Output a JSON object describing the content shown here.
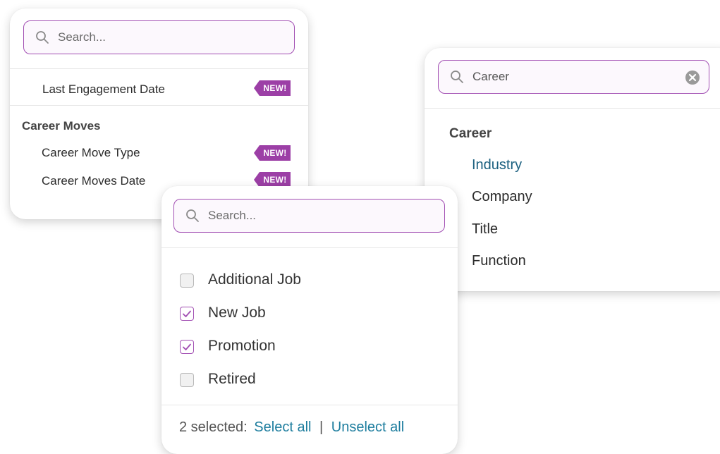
{
  "panel_left": {
    "search_placeholder": "Search...",
    "items": [
      {
        "label": "Last Engagement Date",
        "badge": "NEW!"
      }
    ],
    "group": {
      "label": "Career Moves",
      "items": [
        {
          "label": "Career Move Type",
          "badge": "NEW!"
        },
        {
          "label": "Career Moves Date",
          "badge": "NEW!"
        }
      ]
    }
  },
  "panel_right": {
    "search_value": "Career",
    "group_label": "Career",
    "items": [
      {
        "label": "Industry",
        "highlighted": true
      },
      {
        "label": "Company"
      },
      {
        "label": "Title"
      },
      {
        "label": "Function"
      }
    ]
  },
  "panel_middle": {
    "search_placeholder": "Search...",
    "options": [
      {
        "label": "Additional Job",
        "checked": false
      },
      {
        "label": "New Job",
        "checked": true
      },
      {
        "label": "Promotion",
        "checked": true
      },
      {
        "label": "Retired",
        "checked": false
      }
    ],
    "footer": {
      "selected_count": "2 selected:",
      "select_all": "Select all",
      "separator": "|",
      "unselect_all": "Unselect all"
    }
  },
  "colors": {
    "accent_purple": "#a24fb3",
    "badge_purple": "#9c3fa6",
    "link_teal": "#1d7d9e",
    "highlight_blue": "#1a5f7f"
  },
  "icons": [
    "search-icon",
    "clear-icon",
    "check-icon"
  ]
}
